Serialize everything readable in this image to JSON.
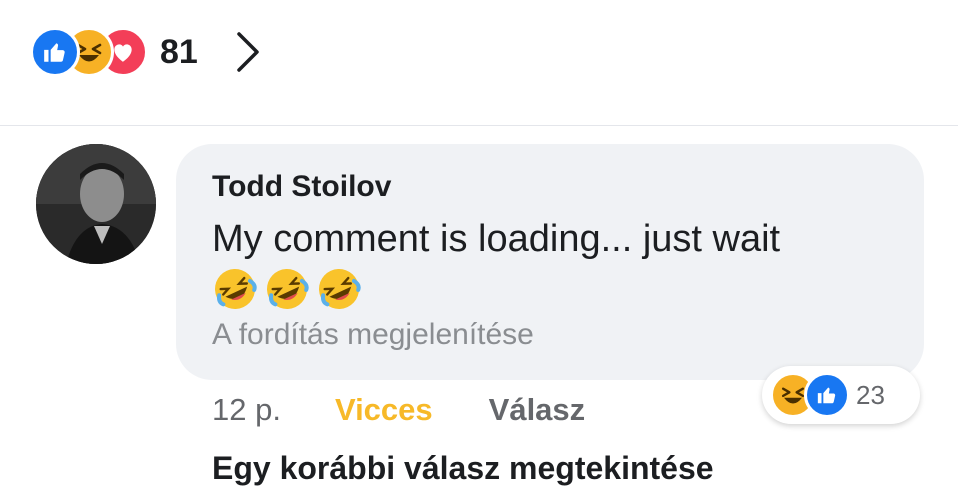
{
  "post_reactions": {
    "icons": [
      "like-icon",
      "haha-icon",
      "love-icon"
    ],
    "count": "81"
  },
  "comment": {
    "author": "Todd Stoilov",
    "text": "My comment is loading... just wait",
    "emojis": [
      "rolling-on-floor-laughing",
      "rolling-on-floor-laughing",
      "rolling-on-floor-laughing"
    ],
    "translate_label": "A fordítás megjelenítése",
    "time": "12 p.",
    "reaction_label": "Vicces",
    "reply_label": "Válasz",
    "reactions": {
      "icons": [
        "haha-icon",
        "like-icon"
      ],
      "count": "23"
    }
  },
  "previous_replies_label": "Egy korábbi válasz megtekintése",
  "colors": {
    "like": "#1877f2",
    "haha": "#f7b125",
    "love": "#f33e58",
    "vicces": "#f7b928",
    "bubble": "#f0f2f5"
  }
}
